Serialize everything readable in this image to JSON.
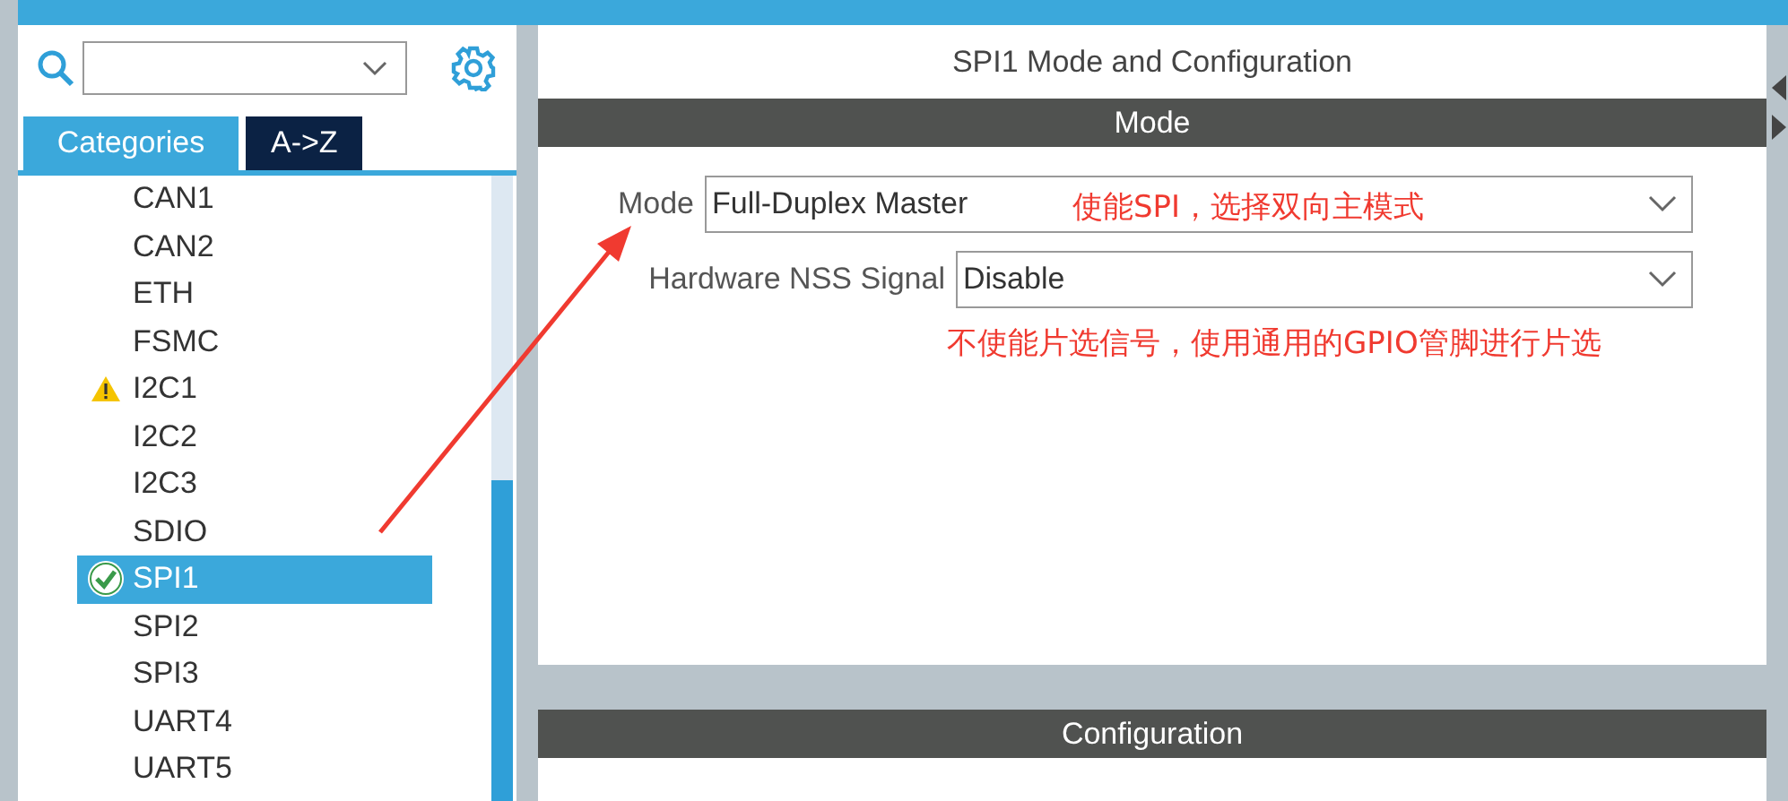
{
  "sidebar": {
    "tabs": [
      {
        "label": "Categories",
        "selected": true
      },
      {
        "label": "A->Z",
        "selected": false
      }
    ],
    "items": [
      {
        "label": "CAN1",
        "selected": false,
        "warning": false,
        "configured": false
      },
      {
        "label": "CAN2",
        "selected": false,
        "warning": false,
        "configured": false
      },
      {
        "label": "ETH",
        "selected": false,
        "warning": false,
        "configured": false
      },
      {
        "label": "FSMC",
        "selected": false,
        "warning": false,
        "configured": false
      },
      {
        "label": "I2C1",
        "selected": false,
        "warning": true,
        "configured": false
      },
      {
        "label": "I2C2",
        "selected": false,
        "warning": false,
        "configured": false
      },
      {
        "label": "I2C3",
        "selected": false,
        "warning": false,
        "configured": false
      },
      {
        "label": "SDIO",
        "selected": false,
        "warning": false,
        "configured": false
      },
      {
        "label": "SPI1",
        "selected": true,
        "warning": false,
        "configured": true
      },
      {
        "label": "SPI2",
        "selected": false,
        "warning": false,
        "configured": false
      },
      {
        "label": "SPI3",
        "selected": false,
        "warning": false,
        "configured": false
      },
      {
        "label": "UART4",
        "selected": false,
        "warning": false,
        "configured": false
      },
      {
        "label": "UART5",
        "selected": false,
        "warning": false,
        "configured": false
      }
    ]
  },
  "panel": {
    "title": "SPI1 Mode and Configuration",
    "mode_header": "Mode",
    "fields": [
      {
        "label": "Mode",
        "value": "Full-Duplex Master",
        "annotation": "使能SPI，选择双向主模式"
      },
      {
        "label": "Hardware NSS Signal",
        "value": "Disable",
        "annotation": "不使能片选信号，使用通用的GPIO管脚进行片选"
      }
    ],
    "config_header": "Configuration"
  }
}
